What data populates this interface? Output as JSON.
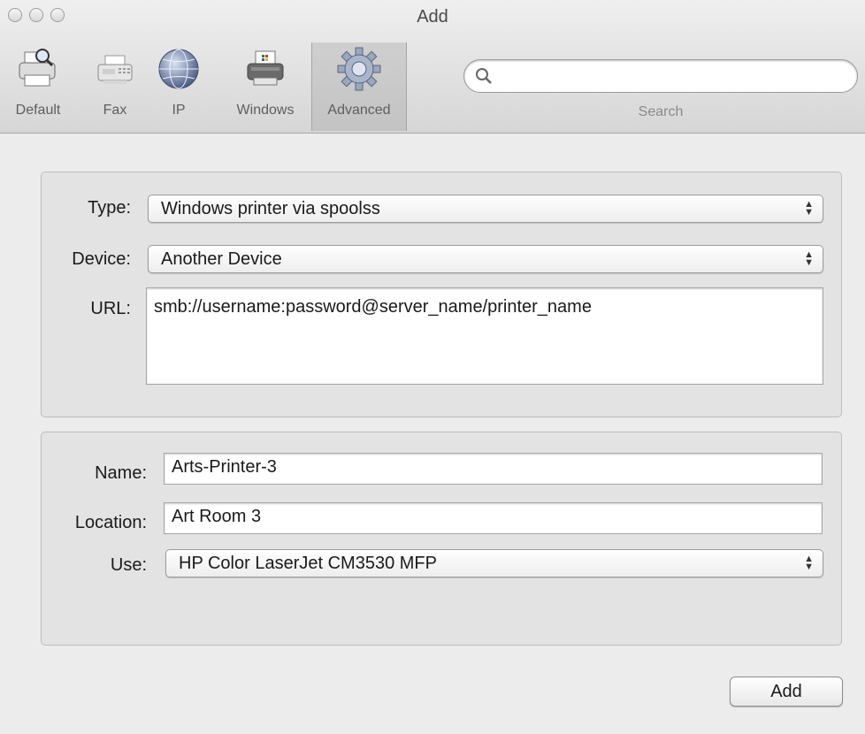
{
  "window": {
    "title": "Add"
  },
  "toolbar": {
    "tools": [
      {
        "label": "Default",
        "icon": "printer-magnifier-icon"
      },
      {
        "label": "Fax",
        "icon": "fax-icon"
      },
      {
        "label": "IP",
        "icon": "globe-icon"
      },
      {
        "label": "Windows",
        "icon": "windows-printer-icon"
      },
      {
        "label": "Advanced",
        "icon": "gear-icon"
      }
    ],
    "selected": "Advanced",
    "search": {
      "label": "Search",
      "value": ""
    }
  },
  "connection": {
    "type_label": "Type:",
    "type_value": "Windows printer via spoolss",
    "device_label": "Device:",
    "device_value": "Another Device",
    "url_label": "URL:",
    "url_value": "smb://username:password@server_name/printer_name"
  },
  "printer": {
    "name_label": "Name:",
    "name_value": "Arts-Printer-3",
    "location_label": "Location:",
    "location_value": "Art Room 3",
    "use_label": "Use:",
    "use_value": "HP Color LaserJet CM3530 MFP"
  },
  "actions": {
    "add_label": "Add"
  },
  "colors": {
    "window_bg": "#ececec",
    "panel_bg": "#e3e3e3",
    "toolbar_selected": "#c9c9c9"
  }
}
